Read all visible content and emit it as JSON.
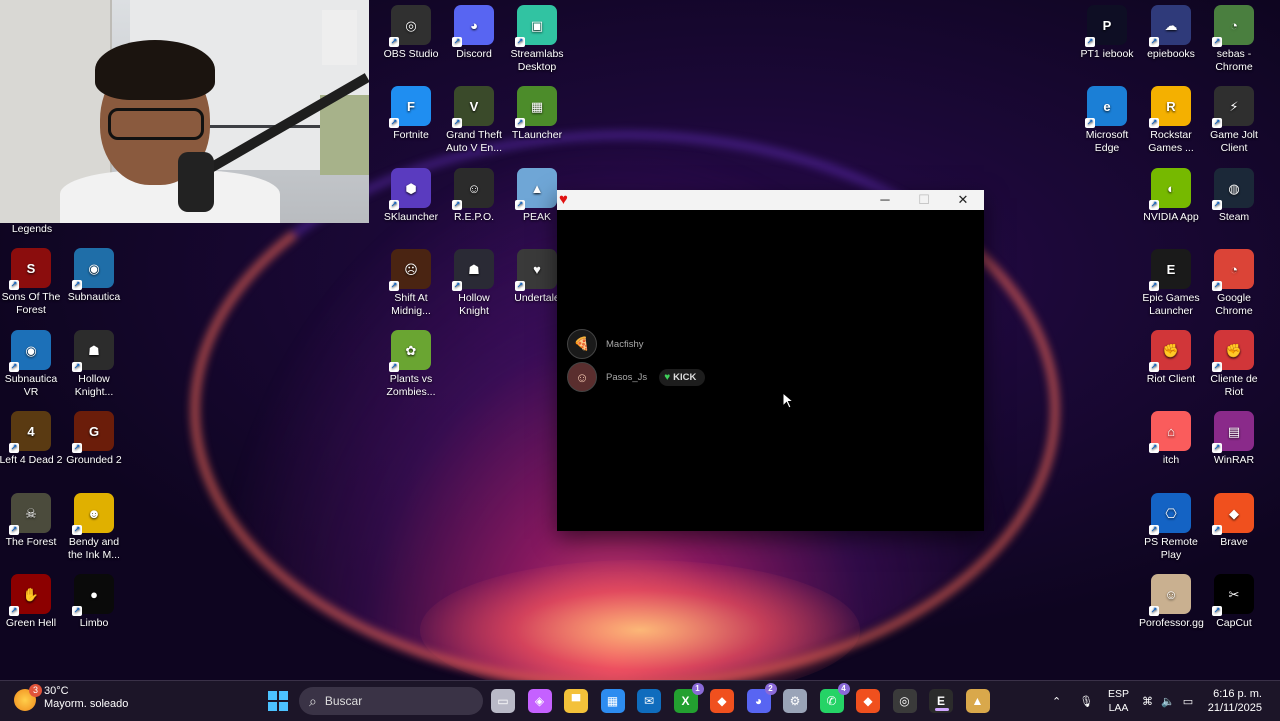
{
  "desktop": {
    "webcam_caption": "Legends",
    "left_icons": [
      {
        "label": "Sons Of The Forest",
        "color": "#8b0d0d",
        "glyph": "S"
      },
      {
        "label": "Subnautica",
        "color": "#1f6ea8",
        "glyph": "◉"
      },
      {
        "label": "Subnautica VR",
        "color": "#1c70b8",
        "glyph": "◉"
      },
      {
        "label": "Hollow Knight...",
        "color": "#2c2c2c",
        "glyph": "☗"
      },
      {
        "label": "Left 4 Dead 2",
        "color": "#5a3a12",
        "glyph": "4"
      },
      {
        "label": "Grounded 2",
        "color": "#6b1d0a",
        "glyph": "G"
      },
      {
        "label": "The Forest",
        "color": "#4b4b3c",
        "glyph": "☠"
      },
      {
        "label": "Bendy and the Ink M...",
        "color": "#e0b000",
        "glyph": "☻"
      },
      {
        "label": "Green Hell",
        "color": "#8c0000",
        "glyph": "✋"
      },
      {
        "label": "Limbo",
        "color": "#0a0a0a",
        "glyph": "●"
      }
    ],
    "middle_icons": [
      {
        "label": "OBS Studio",
        "color": "#303030",
        "glyph": "◎"
      },
      {
        "label": "Discord",
        "color": "#5865f2",
        "glyph": "◕"
      },
      {
        "label": "Streamlabs Desktop",
        "color": "#31c3a2",
        "glyph": "▣"
      },
      {
        "label": "Fortnite",
        "color": "#1f8ef1",
        "glyph": "F"
      },
      {
        "label": "Grand Theft Auto V En...",
        "color": "#3a4a2a",
        "glyph": "V"
      },
      {
        "label": "TLauncher",
        "color": "#4c8c2a",
        "glyph": "▦"
      },
      {
        "label": "SKlauncher",
        "color": "#5a3bbf",
        "glyph": "⬢"
      },
      {
        "label": "R.E.P.O.",
        "color": "#2b2b2b",
        "glyph": "☺"
      },
      {
        "label": "PEAK",
        "color": "#6fa6d6",
        "glyph": "▲"
      },
      {
        "label": "Shift At Midnig...",
        "color": "#4a2412",
        "glyph": "☹"
      },
      {
        "label": "Hollow Knight",
        "color": "#2a2a35",
        "glyph": "☗"
      },
      {
        "label": "Undertale",
        "color": "#3a3a3a",
        "glyph": "♥"
      },
      {
        "label": "Plants vs Zombies...",
        "color": "#6aa532",
        "glyph": "✿"
      }
    ],
    "right_icons": [
      {
        "label": "PT1 iebook",
        "color": "#0e0e24",
        "glyph": "P"
      },
      {
        "label": "epiebooks",
        "color": "#2f3a7a",
        "glyph": "☁"
      },
      {
        "label": "sebas - Chrome",
        "color": "#4a7f3f",
        "glyph": "◔"
      },
      {
        "label": "Microsoft Edge",
        "color": "#1b7fd6",
        "glyph": "e"
      },
      {
        "label": "Rockstar Games ...",
        "color": "#f4b000",
        "glyph": "R"
      },
      {
        "label": "Game Jolt Client",
        "color": "#2f2f2f",
        "glyph": "⚡"
      },
      {
        "label": "NVIDIA App",
        "color": "#76b900",
        "glyph": "◐"
      },
      {
        "label": "Steam",
        "color": "#1b2838",
        "glyph": "◍"
      },
      {
        "label": "Epic Games Launcher",
        "color": "#1a1a1a",
        "glyph": "E"
      },
      {
        "label": "Google Chrome",
        "color": "#db4437",
        "glyph": "◔"
      },
      {
        "label": "Riot Client",
        "color": "#d13639",
        "glyph": "✊"
      },
      {
        "label": "Cliente de Riot",
        "color": "#d13639",
        "glyph": "✊"
      },
      {
        "label": "itch",
        "color": "#fa5c5c",
        "glyph": "⌂"
      },
      {
        "label": "WinRAR",
        "color": "#8a2a8a",
        "glyph": "▤"
      },
      {
        "label": "PS Remote Play",
        "color": "#1463c4",
        "glyph": "⎔"
      },
      {
        "label": "Brave",
        "color": "#f0501e",
        "glyph": "◆"
      },
      {
        "label": "Porofessor.gg",
        "color": "#c9b090",
        "glyph": "☺"
      },
      {
        "label": "CapCut",
        "color": "#000000",
        "glyph": "✂"
      }
    ]
  },
  "overlay_window": {
    "controls": {
      "minimize": "─",
      "maximize": "☐",
      "close": "✕"
    },
    "entries": [
      {
        "name": "Macfishy",
        "avatar": "🍕"
      },
      {
        "name": "Pasos_Js",
        "avatar": "☺",
        "badge": "KICK",
        "badge_color": "#3fd15a"
      }
    ]
  },
  "taskbar": {
    "weather": {
      "temp": "30°C",
      "desc": "Mayorm. soleado",
      "notification": "3"
    },
    "search_placeholder": "Buscar",
    "apps": [
      {
        "name": "task-view",
        "glyph": "▭",
        "color": "#b9b9c7"
      },
      {
        "name": "copilot",
        "glyph": "◈",
        "color": "#c561ff"
      },
      {
        "name": "file-explorer",
        "glyph": "▀",
        "color": "#f3c13a"
      },
      {
        "name": "microsoft-store",
        "glyph": "▦",
        "color": "#2d8cf0"
      },
      {
        "name": "outlook",
        "glyph": "✉",
        "color": "#0f6cbd"
      },
      {
        "name": "xbox",
        "glyph": "X",
        "color": "#23a030",
        "badge": "1"
      },
      {
        "name": "brave",
        "glyph": "◆",
        "color": "#f0501e"
      },
      {
        "name": "discord",
        "glyph": "◕",
        "color": "#5865f2",
        "badge": "2"
      },
      {
        "name": "settings",
        "glyph": "⚙",
        "color": "#9aa4b8"
      },
      {
        "name": "whatsapp",
        "glyph": "✆",
        "color": "#25d366",
        "badge": "4"
      },
      {
        "name": "brave-2",
        "glyph": "◆",
        "color": "#f0501e"
      },
      {
        "name": "obs",
        "glyph": "◎",
        "color": "#3a3a3a"
      },
      {
        "name": "epic-games",
        "glyph": "E",
        "color": "#2b2b2b"
      },
      {
        "name": "undertale",
        "glyph": "▲",
        "color": "#d9a84b"
      }
    ],
    "lang": {
      "line1": "ESP",
      "line2": "LAA"
    },
    "clock": {
      "time": "6:16 p. m.",
      "date": "21/11/2025"
    }
  }
}
